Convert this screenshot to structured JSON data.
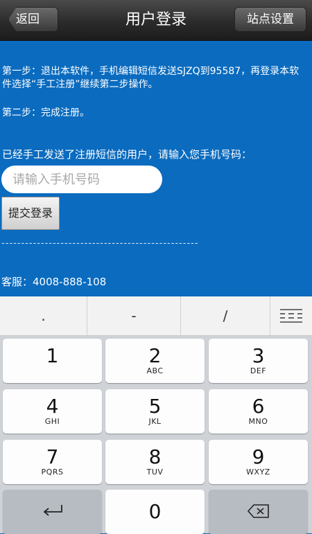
{
  "header": {
    "back_label": "返回",
    "title": "用户登录",
    "site_settings_label": "站点设置"
  },
  "content": {
    "step1": "第一步：退出本软件，手机编辑短信发送SJZQ到95587，再登录本软件选择“手工注册”继续第二步操作。",
    "step2": "第二步：完成注册。",
    "prompt": "已经手工发送了注册短信的用户，请输入您手机号码：",
    "phone_placeholder": "请输入手机号码",
    "submit_label": "提交登录",
    "divider": "--------------------------------------------------",
    "service": "客服：4008-888-108"
  },
  "keyboard": {
    "symbols": [
      ".",
      "-",
      "/"
    ],
    "symbol_panel_icon": "keyboard-lines-icon",
    "keys": [
      {
        "num": "1",
        "letters": ""
      },
      {
        "num": "2",
        "letters": "ABC"
      },
      {
        "num": "3",
        "letters": "DEF"
      },
      {
        "num": "4",
        "letters": "GHI"
      },
      {
        "num": "5",
        "letters": "JKL"
      },
      {
        "num": "6",
        "letters": "MNO"
      },
      {
        "num": "7",
        "letters": "PQRS"
      },
      {
        "num": "8",
        "letters": "TUV"
      },
      {
        "num": "9",
        "letters": "WXYZ"
      }
    ],
    "zero": "0",
    "enter_icon": "return-arrow-icon",
    "delete_icon": "backspace-icon"
  },
  "colors": {
    "background": "#0a6bbf",
    "header": "#2b2b2b",
    "keypad": "#cfd2d6"
  }
}
